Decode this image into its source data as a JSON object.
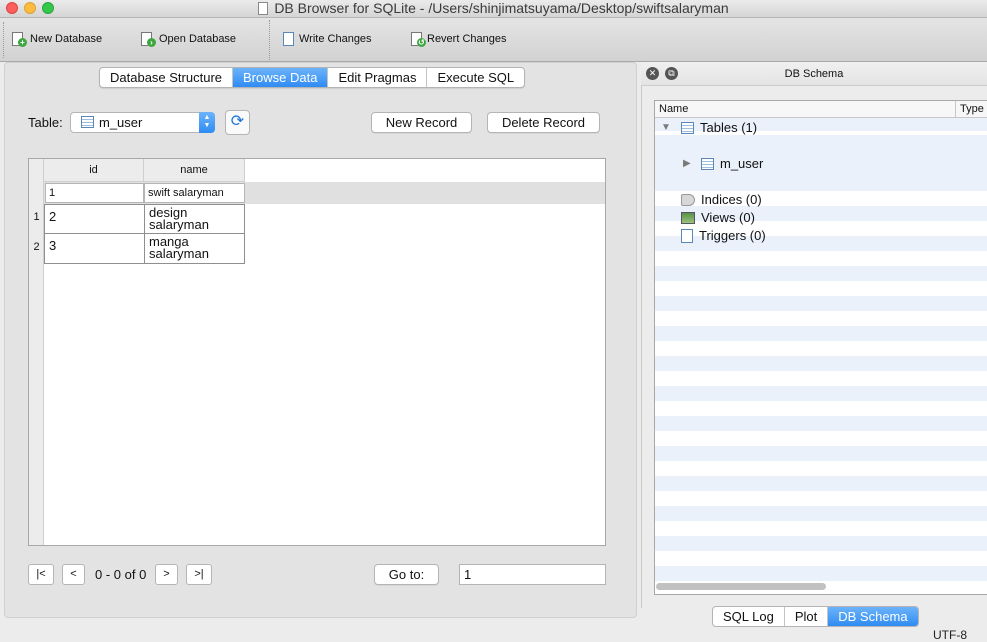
{
  "window": {
    "title": "DB Browser for SQLite - /Users/shinjimatsuyama/Desktop/swiftsalaryman"
  },
  "toolbar": {
    "new_database": "New Database",
    "open_database": "Open Database",
    "write_changes": "Write Changes",
    "revert_changes": "Revert Changes"
  },
  "tabs": [
    {
      "label": "Database Structure",
      "active": false
    },
    {
      "label": "Browse Data",
      "active": true
    },
    {
      "label": "Edit Pragmas",
      "active": false
    },
    {
      "label": "Execute SQL",
      "active": false
    }
  ],
  "browse": {
    "table_label": "Table:",
    "table_selected": "m_user",
    "new_record": "New Record",
    "delete_record": "Delete Record",
    "columns": [
      "id",
      "name"
    ],
    "filters": [
      "1",
      "swift salaryman"
    ],
    "rows": [
      {
        "rownum": "1",
        "id": "2",
        "name": "design salaryman"
      },
      {
        "rownum": "2",
        "id": "3",
        "name": "manga salaryman"
      }
    ]
  },
  "navigation": {
    "first": "|<",
    "prev": "<",
    "range": "0 - 0 of 0",
    "next": ">",
    "last": ">|",
    "goto_label": "Go to:",
    "goto_value": "1"
  },
  "schema": {
    "title": "DB Schema",
    "col_name": "Name",
    "col_type": "Type",
    "tables": "Tables (1)",
    "table_item": "m_user",
    "indices": "Indices (0)",
    "views": "Views (0)",
    "triggers": "Triggers (0)"
  },
  "bottom_tabs": [
    {
      "label": "SQL Log",
      "active": false
    },
    {
      "label": "Plot",
      "active": false
    },
    {
      "label": "DB Schema",
      "active": true
    }
  ],
  "status": {
    "encoding": "UTF-8"
  },
  "colors": {
    "accent": "#2f8cf3",
    "traffic_red": "#fc605c",
    "traffic_yellow": "#fdbc40",
    "traffic_green": "#34c84a"
  }
}
